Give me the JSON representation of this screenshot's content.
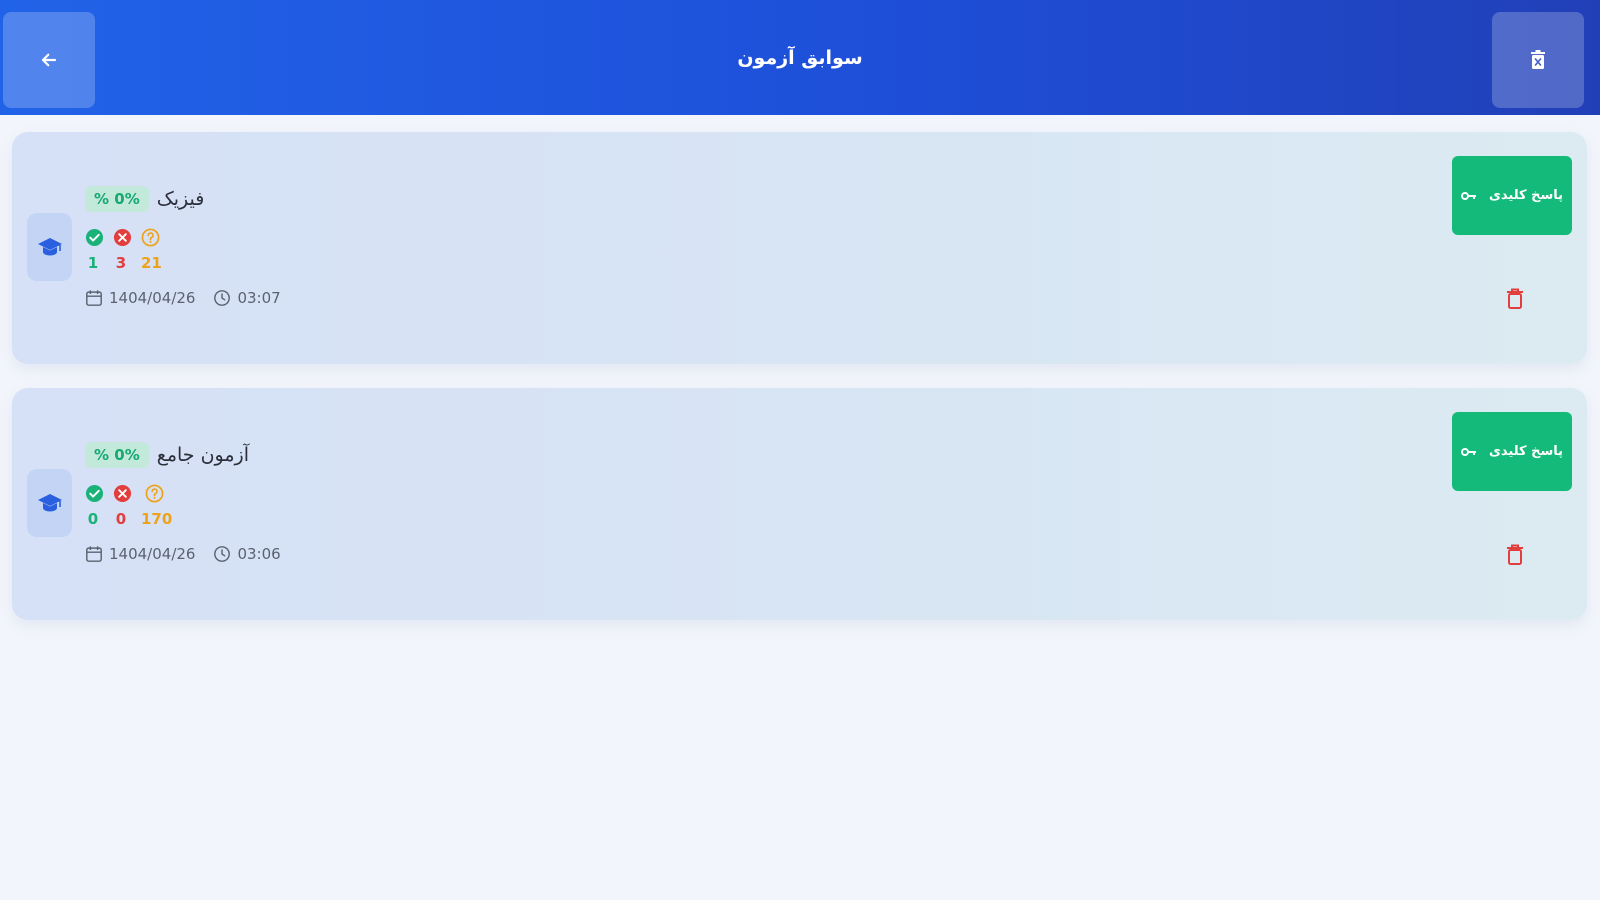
{
  "header": {
    "title": "سوابق آزمون",
    "back_icon": "arrow-left-icon",
    "clear_icon": "trash-x-icon"
  },
  "colors": {
    "header_start": "#2163e8",
    "header_end": "#2140b8",
    "key_button": "#13ba7a",
    "correct": "#1bb27a",
    "wrong": "#e23e3e",
    "unanswered": "#eea21a",
    "delete": "#e23e3e"
  },
  "cards": [
    {
      "name": "فیزیک",
      "percent": "% 0%",
      "correct": "1",
      "wrong": "3",
      "unanswered": "21",
      "date": "1404/04/26",
      "time": "03:07",
      "key_button_label": "پاسخ کلیدی"
    },
    {
      "name": "آزمون جامع",
      "percent": "% 0%",
      "correct": "0",
      "wrong": "0",
      "unanswered": "170",
      "date": "1404/04/26",
      "time": "03:06",
      "key_button_label": "پاسخ کلیدی"
    }
  ]
}
